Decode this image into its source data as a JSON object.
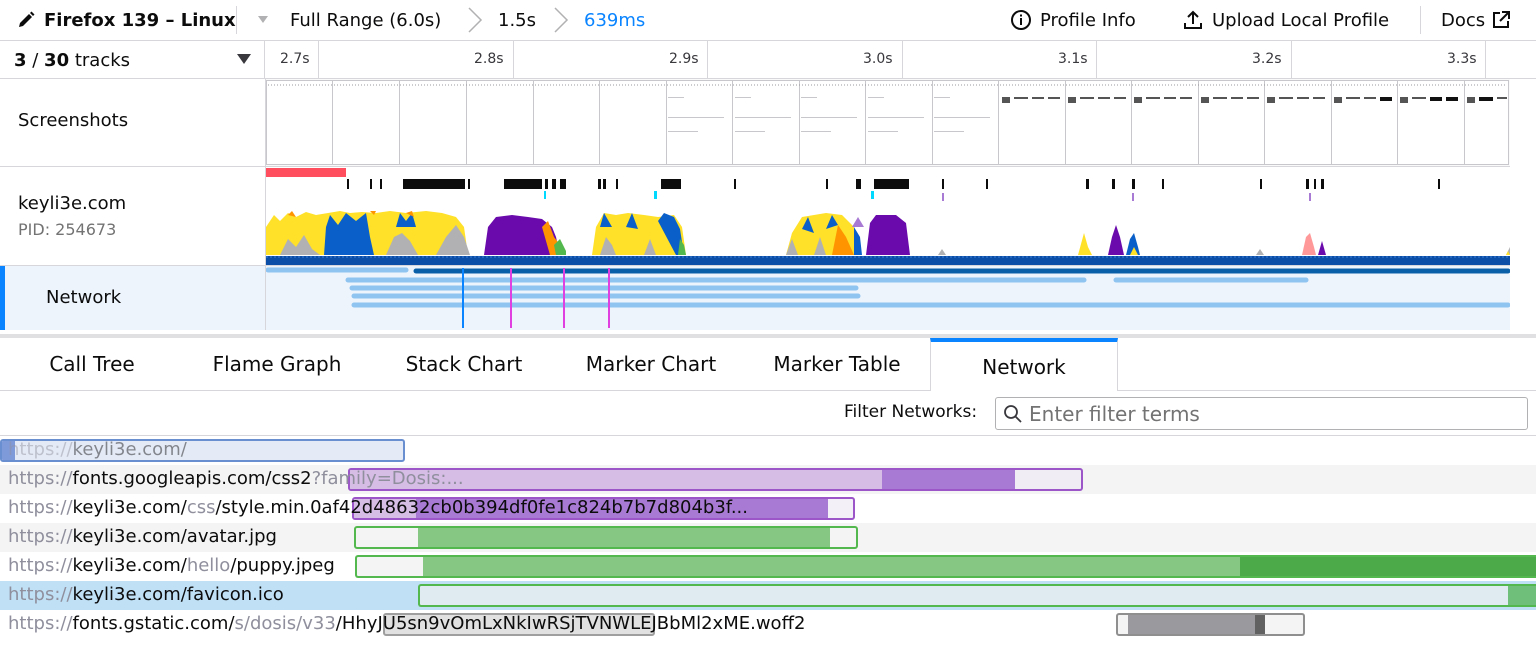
{
  "topbar": {
    "app_title": "Firefox 139 – Linux",
    "breadcrumb_full": "Full Range (6.0s)",
    "breadcrumb_mid": "1.5s",
    "breadcrumb_current": "639ms",
    "profile_info": "Profile Info",
    "upload": "Upload Local Profile",
    "docs": "Docs"
  },
  "tracks": {
    "visible": "3",
    "sep": " / ",
    "total": "30",
    "suffix": " tracks",
    "ticks": [
      "2.7s",
      "2.8s",
      "2.9s",
      "3.0s",
      "3.1s",
      "3.2s",
      "3.3s"
    ],
    "screenshots_label": "Screenshots",
    "process_name": "keyli3e.com",
    "process_pid": "PID: 254673",
    "network_label": "Network"
  },
  "tabs": [
    "Call Tree",
    "Flame Graph",
    "Stack Chart",
    "Marker Chart",
    "Marker Table",
    "Network"
  ],
  "selected_tab": "Network",
  "filter": {
    "label": "Filter Networks:",
    "placeholder": "Enter filter terms"
  },
  "network_rows": [
    {
      "scheme": "https://",
      "host": "keyli3e.com/",
      "path_dim": "",
      "path": "",
      "selected": false
    },
    {
      "scheme": "https://",
      "host": "fonts.googleapis.com/css2",
      "path_dim": "?family=Dosis:...",
      "path": "",
      "selected": false
    },
    {
      "scheme": "https://",
      "host": "keyli3e.com/",
      "path_dim": "css",
      "path": "/style.min.0af42d48632cb0b394df0fe1c824b7b7d804b3f...",
      "selected": false
    },
    {
      "scheme": "https://",
      "host": "keyli3e.com/avatar.jpg",
      "path_dim": "",
      "path": "",
      "selected": false
    },
    {
      "scheme": "https://",
      "host": "keyli3e.com/",
      "path_dim": "hello",
      "path": "/puppy.jpeg",
      "selected": false
    },
    {
      "scheme": "https://",
      "host": "keyli3e.com/favicon.ico",
      "path_dim": "",
      "path": "",
      "selected": true
    },
    {
      "scheme": "https://",
      "host": "fonts.gstatic.com/",
      "path_dim": "s/dosis/v33",
      "path": "/HhyJU5sn9vOmLxNkIwRSjTVNWLEJBbMl2xME.woff2",
      "selected": false
    }
  ],
  "colors": {
    "accent": "#0a84ff",
    "yellow": "#ffe129",
    "blue": "#0a60c8",
    "purple": "#6a0aac",
    "gray": "#b1b1b3",
    "orange": "#ff9400",
    "green": "#53b84d",
    "lilac": "#a97ad3",
    "pink": "#ff4f5e"
  }
}
